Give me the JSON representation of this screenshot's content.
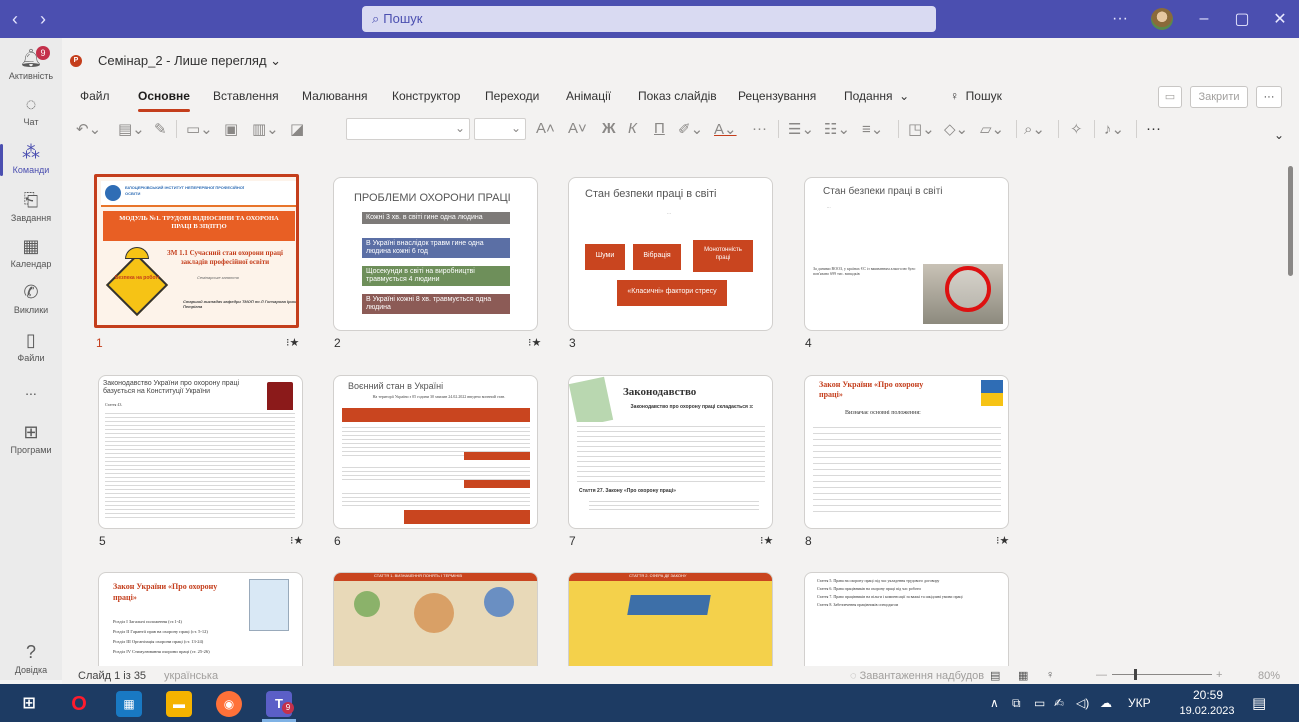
{
  "search": {
    "placeholder": "Пошук"
  },
  "rail": [
    {
      "label": "Активність",
      "badge": "9"
    },
    {
      "label": "Чат"
    },
    {
      "label": "Команди"
    },
    {
      "label": "Завдання"
    },
    {
      "label": "Календар"
    },
    {
      "label": "Виклики"
    },
    {
      "label": "Файли"
    },
    {
      "label": "..."
    },
    {
      "label": "Програми"
    },
    {
      "label": "Довідка"
    }
  ],
  "doc": {
    "title": "Семінар_2 - Лише перегляд",
    "logo": "P"
  },
  "menu": [
    "Файл",
    "Основне",
    "Вставлення",
    "Малювання",
    "Конструктор",
    "Переходи",
    "Анімації",
    "Показ слайдів",
    "Рецензування",
    "Подання",
    "Пошук"
  ],
  "buttons": {
    "close": "Закрити",
    "more": "···"
  },
  "slides": [
    {
      "num": "1",
      "star": true,
      "title": "МОДУЛЬ №1. ТРУДОВІ ВІДНОСИНИ ТА ОХОРОНА ПРАЦІ В ЗП(ПТ)О",
      "subtitle": "ЗМ 1.1 Сучасний стан охорони праці закладів професійної освіти",
      "sign": "Безпека на роботі",
      "inst": "БІЛОЦЕРКІВСЬКИЙ ІНСТИТУТ НЕПЕРЕРВНОЇ ПРОФЕСІЙНОЇ ОСВІТИ",
      "kind": "Семінарське заняття",
      "author": "Старший викладач кафедри ТМОП по Л Гончарова Ірина Петрівна"
    },
    {
      "num": "2",
      "star": true,
      "title": "ПРОБЛЕМИ ОХОРОНИ ПРАЦІ",
      "items": [
        "Кожні 3 хв. в світі гине одна людина",
        "В Україні внаслідок травм гине одна людина кожні 6 год",
        "Щосекунди в світі на виробництві травмується 4 людини",
        "В Україні кожні 8 хв. травмується одна людина"
      ]
    },
    {
      "num": "3",
      "star": false,
      "title": "Стан безпеки праці в світі",
      "boxes": [
        "Шуми",
        "Вібрація",
        "Монотонність праці",
        "«Класичні» фактори стресу"
      ]
    },
    {
      "num": "4",
      "star": false,
      "title": "Стан безпеки праці в світі",
      "text": "За даними ВООЗ, у країнах ЄС із вживанням алкоголю було пов'язано 699 тис. випадків"
    },
    {
      "num": "5",
      "star": true,
      "title": "Законодавство України про охорону праці базується на Конституції України",
      "text": "Стаття 43."
    },
    {
      "num": "6",
      "star": false,
      "title": "Воєнний стан в Україні",
      "text": "На території України з 05 години 30 хвилин 24.02.2022 введено воєнний стан."
    },
    {
      "num": "7",
      "star": true,
      "title": "Законодавство",
      "subtitle": "Законодавство про охорону праці складається з:",
      "text": "Стаття 27. Закону «Про охорону праці»"
    },
    {
      "num": "8",
      "star": true,
      "title": "Закон України «Про охорону праці»",
      "text": "Визначає основні положення:"
    },
    {
      "num": "9",
      "star": false,
      "title": "Закон України «Про охорону праці»",
      "items": [
        "Розділ І Загальні положення (ст.1-4)",
        "Розділ ІІ Гарантії прав на охорону праці (ст. 5-12)",
        "Розділ ІІІ Організація охорони праці (ст. 13-24)",
        "Розділ IV Стимулювання охорони праці (ст. 25-26)"
      ]
    },
    {
      "num": "10",
      "star": false,
      "title": "СТАТТЯ 1. ВИЗНАЧЕННЯ ПОНЯТЬ І ТЕРМІНІВ"
    },
    {
      "num": "11",
      "star": false,
      "title": "СТАТТЯ 2. СФЕРА ДІЇ ЗАКОНУ"
    },
    {
      "num": "12",
      "star": false,
      "items": [
        "Стаття 5. Права на охорону праці під час укладення трудового договору",
        "Стаття 6. Права працівників на охорону праці під час роботи",
        "Стаття 7. Право працівників на пільги і компенсації за важкі та шкідливі умови праці",
        "Стаття 8. Забезпечення працівників спецодягом"
      ]
    }
  ],
  "status": {
    "slide": "Слайд 1 із 35",
    "lang": "українська",
    "addins": "Завантаження надбудов",
    "zoom": "80%"
  },
  "taskbar": {
    "time": "20:59",
    "date": "19.02.2023",
    "lang": "УКР",
    "teams_badge": "9"
  },
  "colors": {
    "teams": "#4b4fb0",
    "ppt": "#c43e1c",
    "taskbar": "#1d3b63"
  }
}
